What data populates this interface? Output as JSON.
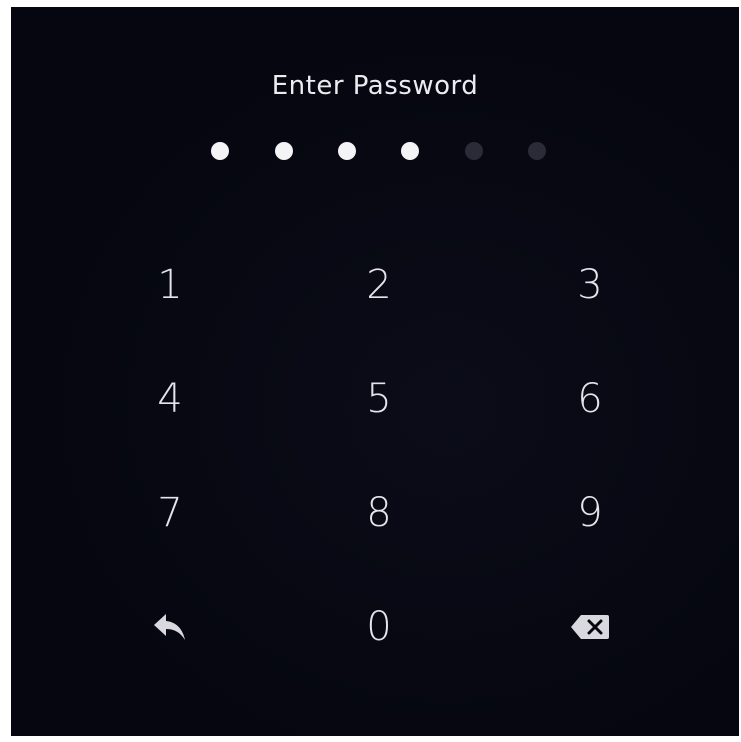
{
  "prompt": {
    "title": "Enter Password"
  },
  "pin": {
    "length": 6,
    "entered": 4
  },
  "keypad": {
    "keys": [
      "1",
      "2",
      "3",
      "4",
      "5",
      "6",
      "7",
      "8",
      "9",
      "0"
    ]
  },
  "icons": {
    "back": "back-arrow-icon",
    "delete": "backspace-icon"
  },
  "colors": {
    "background": "#05060f",
    "dot_filled": "#f4f4f6",
    "dot_empty": "#2a2b36",
    "text": "#e4e4ea"
  }
}
